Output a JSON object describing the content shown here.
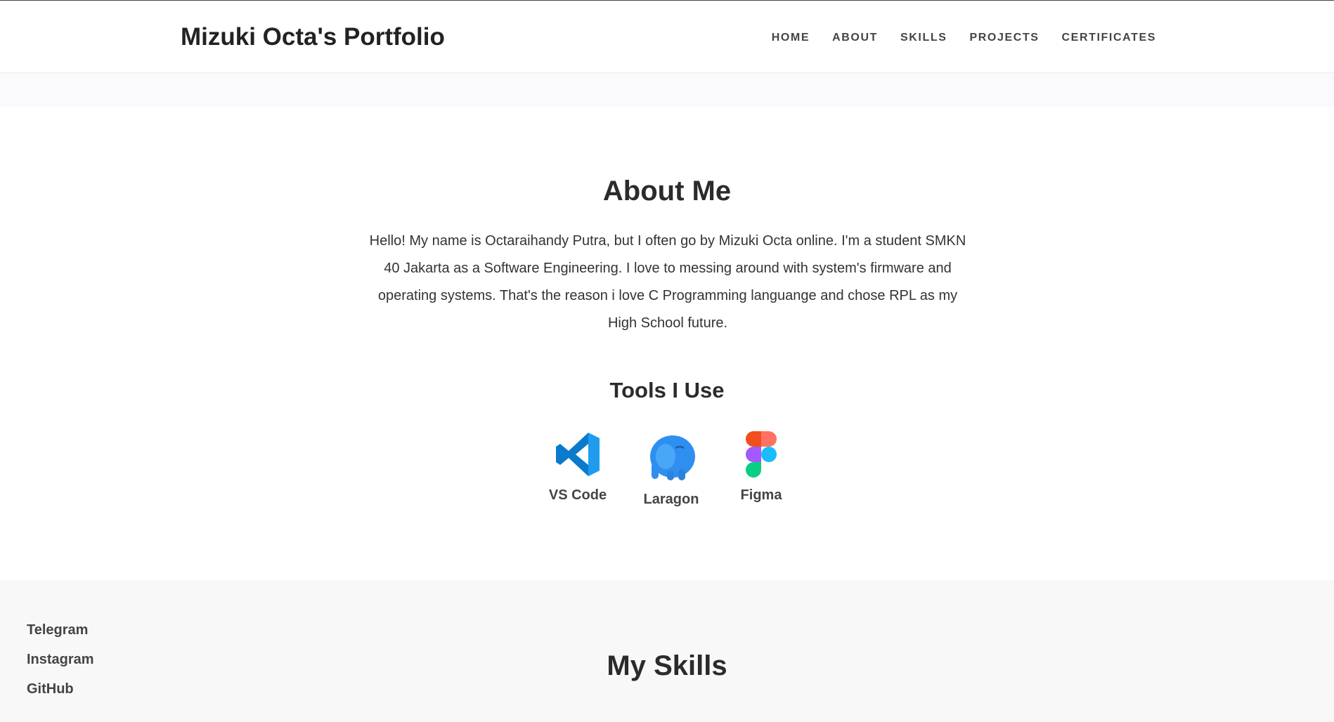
{
  "header": {
    "brand": "Mizuki Octa's Portfolio",
    "nav": [
      "HOME",
      "ABOUT",
      "SKILLS",
      "PROJECTS",
      "CERTIFICATES"
    ]
  },
  "about": {
    "title": "About Me",
    "text": "Hello! My name is Octaraihandy Putra, but I often go by Mizuki Octa online. I'm a student SMKN 40 Jakarta as a Software Engineering. I love to messing around with system's firmware and operating systems. That's the reason i love C Programming languange and chose RPL as my High School future."
  },
  "tools": {
    "title": "Tools I Use",
    "items": [
      {
        "label": "VS Code",
        "icon": "vscode-icon"
      },
      {
        "label": "Laragon",
        "icon": "laragon-elephant-icon"
      },
      {
        "label": "Figma",
        "icon": "figma-icon"
      }
    ]
  },
  "social": [
    "Telegram",
    "Instagram",
    "GitHub"
  ],
  "skills": {
    "title": "My Skills"
  },
  "colors": {
    "vscode": "#0a7acc",
    "laragon": "#2f8ff0",
    "figma_red": "#f24e1e",
    "figma_orange": "#ff7262",
    "figma_purple": "#a259ff",
    "figma_blue": "#1abcfe",
    "figma_green": "#0acf83"
  }
}
